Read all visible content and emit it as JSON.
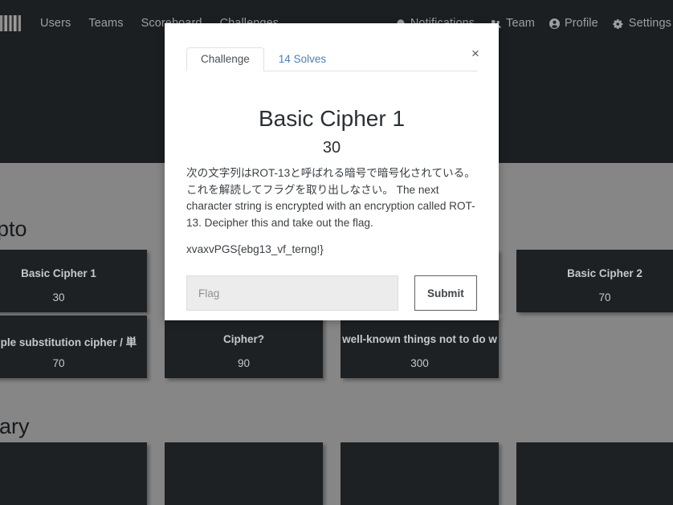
{
  "navbar": {
    "logo_name": "site-logo",
    "left_links": [
      {
        "label": "Users"
      },
      {
        "label": "Teams"
      },
      {
        "label": "Scoreboard"
      },
      {
        "label": "Challenges"
      }
    ],
    "right_items": [
      {
        "label": "Notifications",
        "icon": "bell-icon"
      },
      {
        "label": "Team",
        "icon": "users-icon"
      },
      {
        "label": "Profile",
        "icon": "user-circle-icon"
      },
      {
        "label": "Settings",
        "icon": "gear-icon"
      }
    ]
  },
  "page": {
    "categories": [
      {
        "title": "Crypto"
      },
      {
        "title": "Binary"
      }
    ],
    "cards": [
      {
        "name": "Basic Cipher 1",
        "points": "30"
      },
      {
        "name": "",
        "points": ""
      },
      {
        "name": "",
        "points": ""
      },
      {
        "name": "Basic Cipher 2",
        "points": "70"
      },
      {
        "name": "Simple substitution cipher / 単",
        "points": "70"
      },
      {
        "name": "Cipher?",
        "points": "90"
      },
      {
        "name": "well-known things not to do w",
        "points": "300"
      }
    ]
  },
  "modal": {
    "tabs": [
      {
        "label": "Challenge",
        "active": true
      },
      {
        "label": "14 Solves",
        "active": false
      }
    ],
    "close_icon": "×",
    "title": "Basic Cipher 1",
    "points": "30",
    "description": "次の文字列はROT-13と呼ばれる暗号で暗号化されている。これを解読してフラグを取り出しなさい。 The next character string is encrypted with an encryption called ROT-13. Decipher this and take out the flag.",
    "cipher_text": "xvaxvPGS{ebg13_vf_terng!}",
    "flag_placeholder": "Flag",
    "flag_value": "",
    "submit_label": "Submit"
  },
  "colors": {
    "navbar_bg": "#1b1f22",
    "page_bg": "#868686",
    "card_bg": "#1d2124",
    "link_blue": "#4c7fb8"
  }
}
